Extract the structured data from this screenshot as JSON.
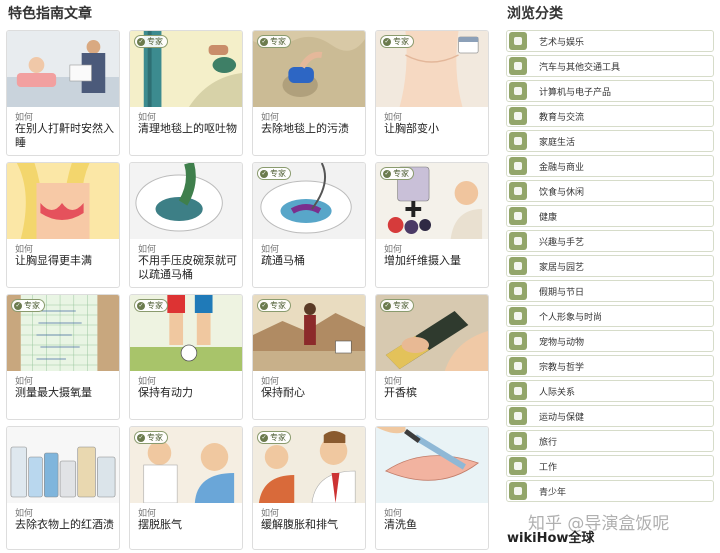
{
  "main": {
    "title": "特色指南文章",
    "expert_label": "专家",
    "articles": [
      {
        "prefix": "如何",
        "title": "在别人打鼾时安然入睡",
        "expert": false
      },
      {
        "prefix": "如何",
        "title": "清理地毯上的呕吐物",
        "expert": true
      },
      {
        "prefix": "如何",
        "title": "去除地毯上的污渍",
        "expert": true
      },
      {
        "prefix": "如何",
        "title": "让胸部变小",
        "expert": true
      },
      {
        "prefix": "如何",
        "title": "让胸显得更丰满",
        "expert": false
      },
      {
        "prefix": "如何",
        "title": "不用手压皮碗泵就可以疏通马桶",
        "expert": false
      },
      {
        "prefix": "如何",
        "title": "疏通马桶",
        "expert": true
      },
      {
        "prefix": "如何",
        "title": "增加纤维摄入量",
        "expert": true
      },
      {
        "prefix": "如何",
        "title": "测量最大摄氧量",
        "expert": true
      },
      {
        "prefix": "如何",
        "title": "保持有动力",
        "expert": true
      },
      {
        "prefix": "如何",
        "title": "保持耐心",
        "expert": true
      },
      {
        "prefix": "如何",
        "title": "开香槟",
        "expert": true
      },
      {
        "prefix": "如何",
        "title": "去除衣物上的红酒渍",
        "expert": false
      },
      {
        "prefix": "如何",
        "title": "摆脱胀气",
        "expert": true
      },
      {
        "prefix": "如何",
        "title": "缓解腹胀和排气",
        "expert": true
      },
      {
        "prefix": "如何",
        "title": "清洗鱼",
        "expert": false
      }
    ]
  },
  "sidebar": {
    "title": "浏览分类",
    "categories": [
      "艺术与娱乐",
      "汽车与其他交通工具",
      "计算机与电子产品",
      "教育与交流",
      "家庭生活",
      "金融与商业",
      "饮食与休闲",
      "健康",
      "兴趣与手艺",
      "家居与园艺",
      "假期与节日",
      "个人形象与时尚",
      "宠物与动物",
      "宗教与哲学",
      "人际关系",
      "运动与保健",
      "旅行",
      "工作",
      "青少年"
    ],
    "global_title": "wikiHow全球"
  },
  "watermark": "知乎 @导演盒饭呢",
  "colors": {
    "category_icon": "#93a66a",
    "expert_badge": "#6b7b4d"
  }
}
